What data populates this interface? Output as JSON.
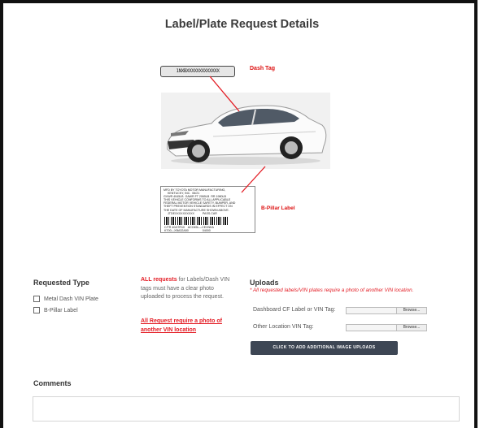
{
  "page": {
    "title": "Label/Plate Request Details"
  },
  "illustration": {
    "dash_tag_text": "1NXBXXXXXXXXXXXXX",
    "dash_tag_label": "Dash Tag",
    "bpillar_label": "B-Pillar Label",
    "pillar_text": "MFD BY TOYOTA MOTOR MANUFACTURING,\n     KENTUCKY, INC.  06/21\nGVWR 4045LB  GAWR FT 2065LB  RR 1980LB\nTHIS VEHICLE CONFORMS TO ALL APPLICABLE\nFEDERAL MOTOR VEHICLE SAFETY, BUMPER, AND\nTHEFT PREVENTION STANDARDS IN EFFECT ON\nTHE DATE OF MANUFACTURE SHOWN ABOVE.\n     JTDEXXXXXXXXXX          PASS.CAR",
    "pillar_foot": "C/TR 40/47R10    ACO45L—CEXNKA\nKT00—XBA32A50                 04000"
  },
  "requested_type": {
    "title": "Requested Type",
    "options": [
      "Metal Dash VIN Plate",
      "B-Pillar Label"
    ]
  },
  "requirements": {
    "lead": "ALL requests",
    "text": " for Labels/Dash VIN tags must have a clear photo uploaded to process the request.",
    "link": "All Request require a photo of another VIN location"
  },
  "uploads": {
    "title": "Uploads",
    "subtitle": "* All requested labels/VIN plates require a photo of another VIN location.",
    "fields": [
      {
        "label": "Dashboard CF Label or VIN Tag:",
        "browse": "Browse..."
      },
      {
        "label": "Other Location VIN Tag:",
        "browse": "Browse..."
      }
    ],
    "add_button": "CLICK TO ADD ADDITIONAL IMAGE UPLOADS"
  },
  "comments": {
    "title": "Comments",
    "value": ""
  },
  "colors": {
    "accent_red": "#e31b23",
    "button_bg": "#3d4654"
  }
}
